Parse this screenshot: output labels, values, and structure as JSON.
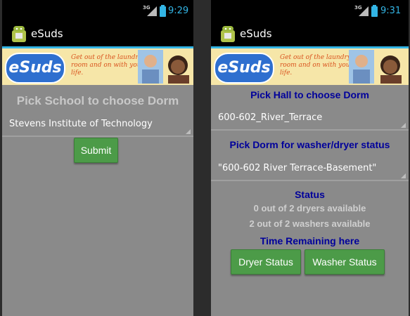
{
  "colors": {
    "accent": "#33b5e5",
    "heading_blue": "#00009b",
    "button_green": "#4c9b48",
    "screen_bg": "#8a8a8a"
  },
  "left": {
    "statusbar": {
      "network": "3G",
      "time": "9:29"
    },
    "app_title": "eSuds",
    "banner": {
      "logo": "eSuds",
      "tagline": "Get out of the laundry room and on with your life."
    },
    "heading": "Pick School to choose Dorm",
    "school_spinner": {
      "value": "Stevens Institute of Technology"
    },
    "submit_label": "Submit"
  },
  "right": {
    "statusbar": {
      "network": "3G",
      "time": "9:31"
    },
    "app_title": "eSuds",
    "banner": {
      "logo": "eSuds",
      "tagline": "Get out of the laundry room and on with your life."
    },
    "hall_heading": "Pick Hall to choose Dorm",
    "hall_spinner": {
      "value": "600-602_River_Terrace"
    },
    "dorm_heading": "Pick Dorm for washer/dryer status",
    "dorm_spinner": {
      "value": "\"600-602 River Terrace-Basement\""
    },
    "status_heading": "Status",
    "dryers_status": "0 out of 2 dryers available",
    "washers_status": "2 out of 2 washers available",
    "time_remaining_heading": "Time Remaining here",
    "dryer_button": "Dryer Status",
    "washer_button": "Washer Status"
  }
}
